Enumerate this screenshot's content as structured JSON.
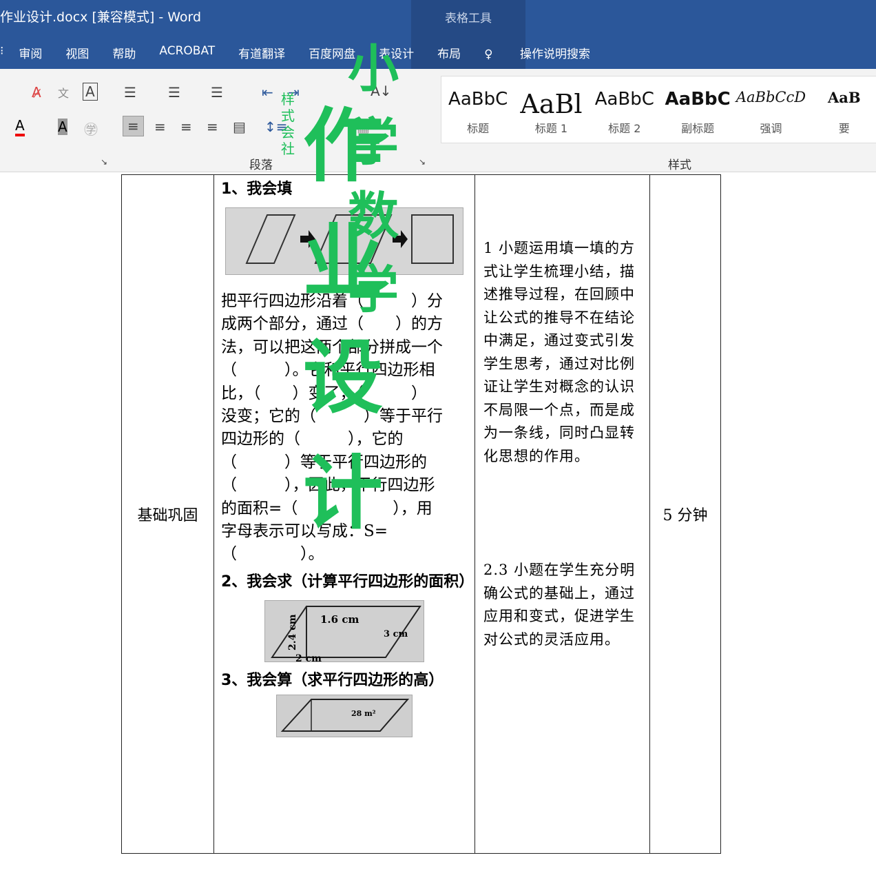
{
  "window": {
    "title": "作业设计.docx [兼容模式]  -  Word",
    "context_tab": "表格工具"
  },
  "tabs": [
    "审阅",
    "视图",
    "帮助",
    "ACROBAT",
    "有道翻译",
    "百度网盘",
    "表设计",
    "布局",
    "操作说明搜索"
  ],
  "ribbon": {
    "groups": [
      "段落",
      "样式"
    ],
    "styles": [
      {
        "sample": "AaBbC",
        "label": "标题"
      },
      {
        "sample": "AaBl",
        "label": "标题 1"
      },
      {
        "sample": "AaBbC",
        "label": "标题 2"
      },
      {
        "sample": "AaBbC",
        "label": "副标题"
      },
      {
        "sample": "AaBbCcD",
        "label": "强调"
      },
      {
        "sample": "AaB",
        "label": "要"
      }
    ]
  },
  "watermark": {
    "line1": "小学数学",
    "line2": "作业设计",
    "small": "样式会社"
  },
  "table": {
    "category": "基础巩固",
    "q1_title": "1、我会填",
    "q1_lines": [
      "把平行四边形沿着（　　　）分",
      "成两个部分，通过（　　）的方",
      "法，可以把这两个部分拼成一个",
      "（　　　）。它和平行四边形相",
      "比，（　　）变了，（　　　）",
      "没变；它的（　　　）等于平行",
      "四边形的（　　　），它的",
      "（　　　）等于平行四边形的",
      "（　　　），因此，平行四边形",
      "的面积=（　　　　　　），用",
      "字母表示可以写成：S=",
      "（　　　　）。"
    ],
    "q2_title": "2、我会求（计算平行四边形的面积）",
    "q2_figure_labels": [
      "1.6 cm",
      "3 cm",
      "2.4 cm",
      "2 cm"
    ],
    "q3_title": "3、我会算（求平行四边形的高）",
    "q3_figure_label": "28 m²",
    "note1": "1 小题运用填一填的方式让学生梳理小结，描述推导过程，在回顾中让公式的推导不在结论中满足，通过变式引发学生思考，通过对比例证让学生对概念的认识不局限一个点，而是成为一条线，同时凸显转化思想的作用。",
    "note2": "2.3 小题在学生充分明确公式的基础上，通过应用和变式，促进学生对公式的灵活应用。",
    "time": "5 分钟"
  }
}
